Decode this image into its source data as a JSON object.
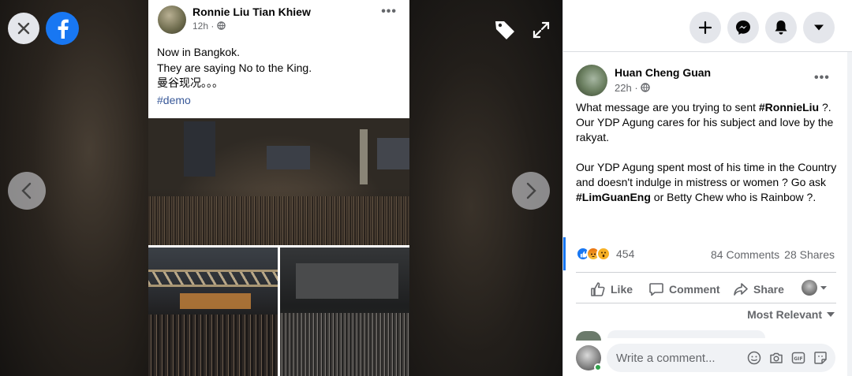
{
  "viewer": {
    "close_icon": "close-icon",
    "logo_icon": "facebook-logo",
    "tag_icon": "tag-icon",
    "expand_icon": "expand-icon",
    "prev_icon": "chevron-left-icon",
    "next_icon": "chevron-right-icon"
  },
  "image_post": {
    "author": "Ronnie Liu Tian Khiew",
    "time": "12h",
    "lines": [
      "Now in Bangkok.",
      "They are saying No to the King.",
      "曼谷现况。。。"
    ],
    "hashtag": "#demo"
  },
  "topbar": {
    "icons": [
      "plus-icon",
      "messenger-icon",
      "bell-icon",
      "caret-down-icon"
    ]
  },
  "comment_post": {
    "author": "Huan Cheng Guan",
    "time": "22h",
    "p1_a": "What message are you trying to sent ",
    "p1_tag": "#RonnieLiu",
    "p1_b": " ?. Our YDP Agung cares for his subject and love by the rakyat.",
    "p2_a": "Our YDP Agung spent most of his time in the Country and doesn't indulge in mistress or women ? Go ask ",
    "p2_tag": "#LimGuanEng",
    "p2_b": " or Betty Chew who is Rainbow ?."
  },
  "stats": {
    "reaction_count": "454",
    "comments": "84 Comments",
    "shares": "28 Shares"
  },
  "actions": {
    "like": "Like",
    "comment": "Comment",
    "share": "Share"
  },
  "sort": {
    "label": "Most Relevant"
  },
  "composer": {
    "placeholder": "Write a comment..."
  },
  "colors": {
    "brand": "#1877f2",
    "online": "#31a24c",
    "muted": "#65676b"
  }
}
